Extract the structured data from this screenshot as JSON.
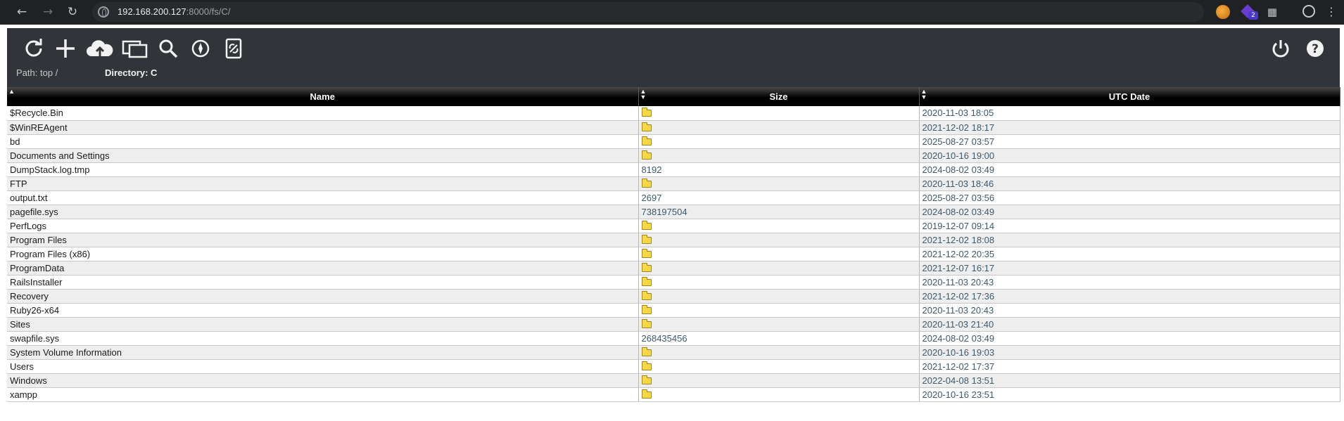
{
  "browser": {
    "url_host": "192.168.200.127",
    "url_rest": ":8000/fs/C/",
    "ext_badge": "2"
  },
  "toolbar": {
    "path_label": "Path:",
    "path_value": "top /",
    "directory_label": "Directory: C",
    "icons": [
      "refresh-icon",
      "add-icon",
      "upload-cloud-icon",
      "windows-icon",
      "search-icon",
      "compass-icon",
      "link-icon",
      "power-icon",
      "help-icon"
    ]
  },
  "table": {
    "columns": [
      "Name",
      "Size",
      "UTC Date"
    ],
    "rows": [
      {
        "name": "$Recycle.Bin",
        "size": "",
        "folder": true,
        "date": "2020-11-03 18:05"
      },
      {
        "name": "$WinREAgent",
        "size": "",
        "folder": true,
        "date": "2021-12-02 18:17"
      },
      {
        "name": "bd",
        "size": "",
        "folder": true,
        "date": "2025-08-27 03:57"
      },
      {
        "name": "Documents and Settings",
        "size": "",
        "folder": true,
        "date": "2020-10-16 19:00"
      },
      {
        "name": "DumpStack.log.tmp",
        "size": "8192",
        "folder": false,
        "date": "2024-08-02 03:49"
      },
      {
        "name": "FTP",
        "size": "",
        "folder": true,
        "date": "2020-11-03 18:46"
      },
      {
        "name": "output.txt",
        "size": "2697",
        "folder": false,
        "date": "2025-08-27 03:56"
      },
      {
        "name": "pagefile.sys",
        "size": "738197504",
        "folder": false,
        "date": "2024-08-02 03:49"
      },
      {
        "name": "PerfLogs",
        "size": "",
        "folder": true,
        "date": "2019-12-07 09:14"
      },
      {
        "name": "Program Files",
        "size": "",
        "folder": true,
        "date": "2021-12-02 18:08"
      },
      {
        "name": "Program Files (x86)",
        "size": "",
        "folder": true,
        "date": "2021-12-02 20:35"
      },
      {
        "name": "ProgramData",
        "size": "",
        "folder": true,
        "date": "2021-12-07 16:17"
      },
      {
        "name": "RailsInstaller",
        "size": "",
        "folder": true,
        "date": "2020-11-03 20:43"
      },
      {
        "name": "Recovery",
        "size": "",
        "folder": true,
        "date": "2021-12-02 17:36"
      },
      {
        "name": "Ruby26-x64",
        "size": "",
        "folder": true,
        "date": "2020-11-03 20:43"
      },
      {
        "name": "Sites",
        "size": "",
        "folder": true,
        "date": "2020-11-03 21:40"
      },
      {
        "name": "swapfile.sys",
        "size": "268435456",
        "folder": false,
        "date": "2024-08-02 03:49"
      },
      {
        "name": "System Volume Information",
        "size": "",
        "folder": true,
        "date": "2020-10-16 19:03"
      },
      {
        "name": "Users",
        "size": "",
        "folder": true,
        "date": "2021-12-02 17:37"
      },
      {
        "name": "Windows",
        "size": "",
        "folder": true,
        "date": "2022-04-08 13:51"
      },
      {
        "name": "xampp",
        "size": "",
        "folder": true,
        "date": "2020-10-16 23:51"
      }
    ]
  }
}
